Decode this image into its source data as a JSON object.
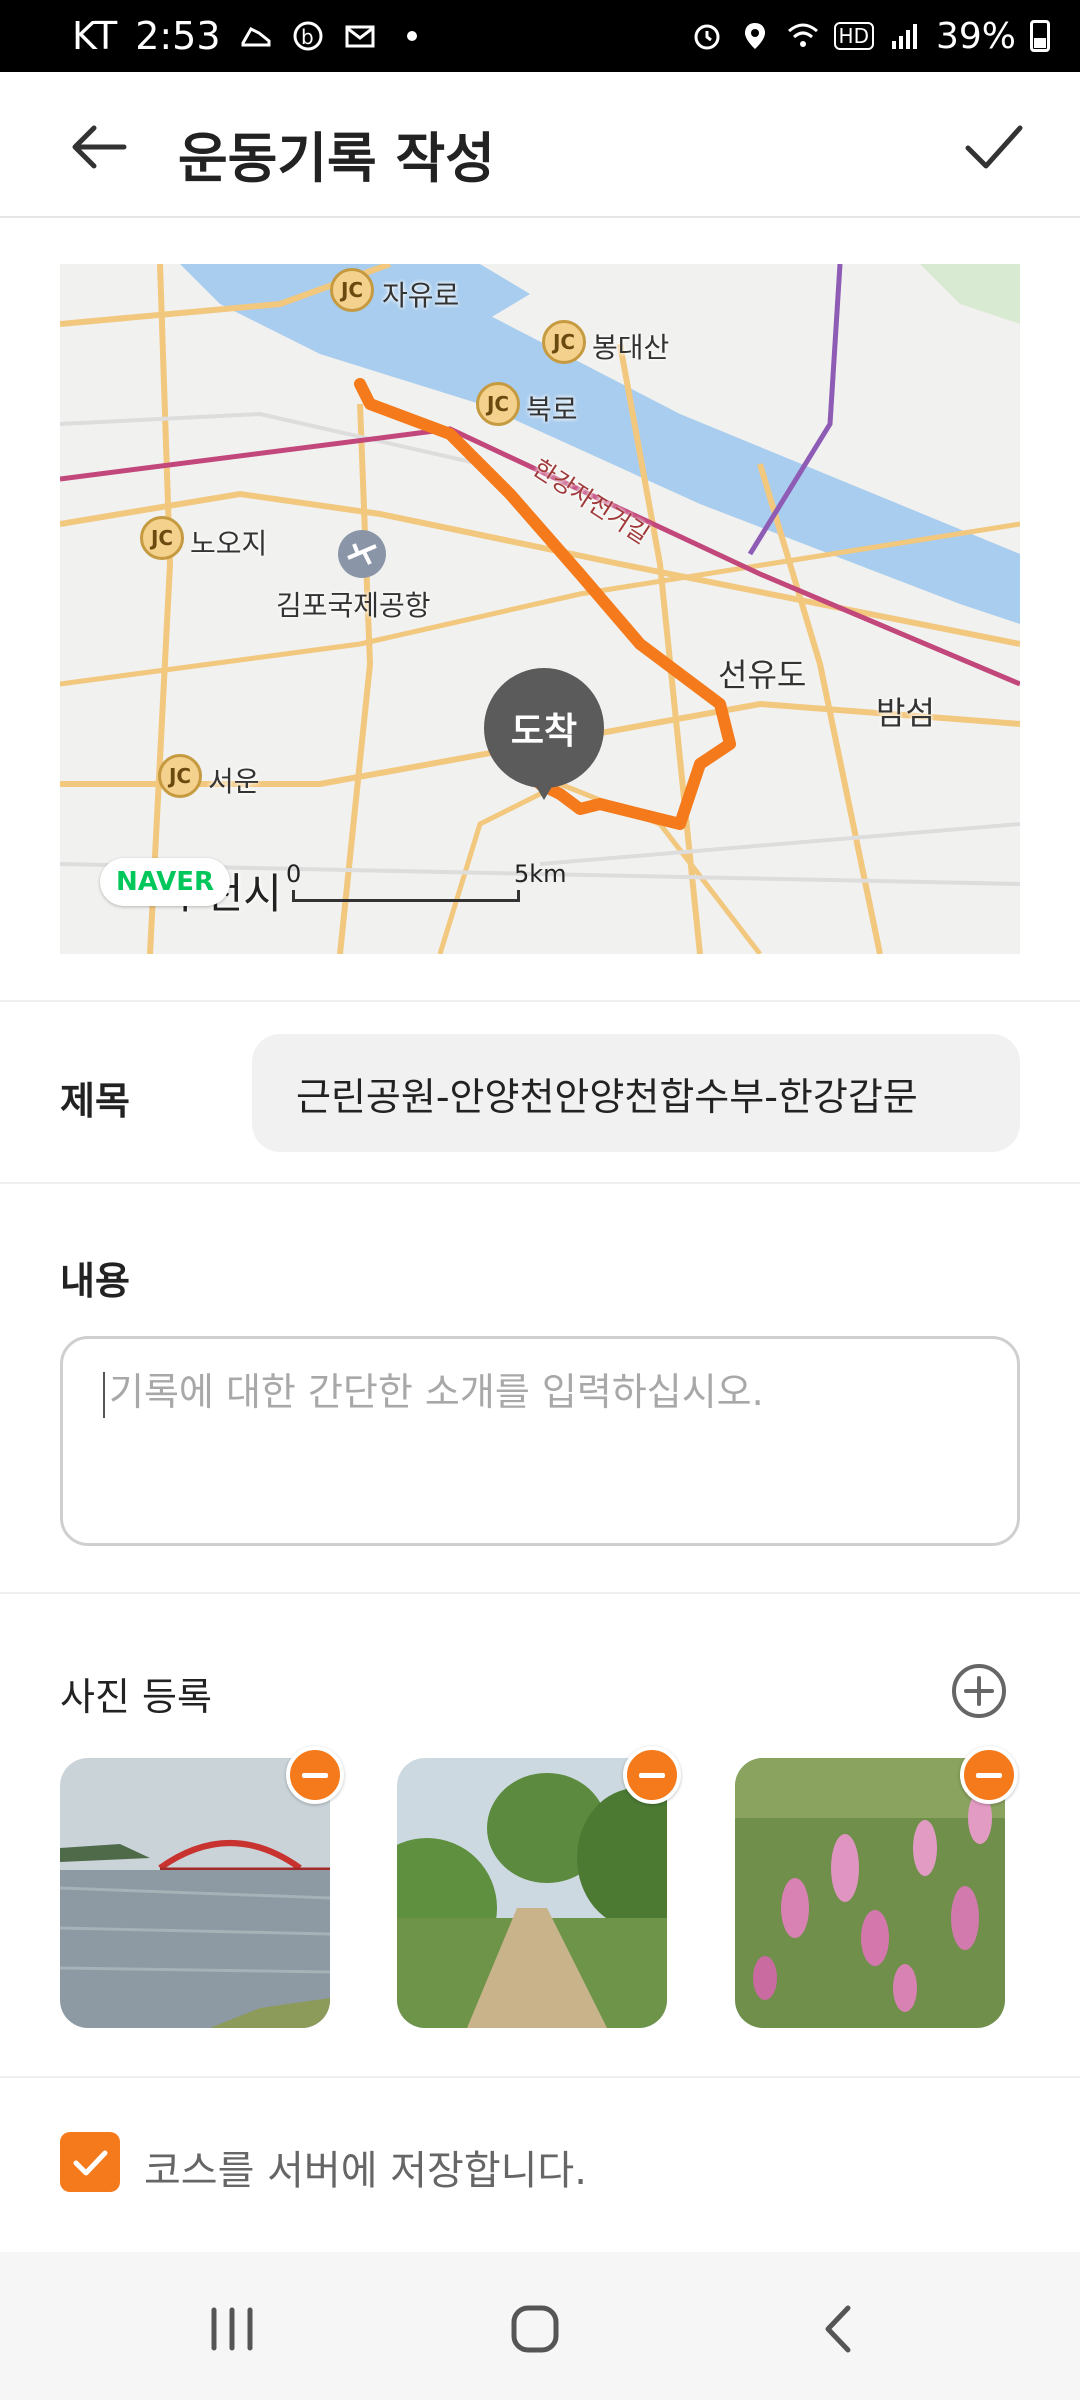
{
  "status_bar": {
    "carrier": "KT",
    "time": "2:53",
    "hd_label": "HD",
    "battery": "39%"
  },
  "app_bar": {
    "title": "운동기록 작성"
  },
  "map": {
    "labels": {
      "jayuro": "자유로",
      "bongdaesan": "봉대산",
      "bukro": "북로",
      "noji": "노오지",
      "airport": "김포국제공항",
      "bike_path": "한강자전거길",
      "seonyudo": "선유도",
      "bamseom": "밤섬",
      "seoun": "서운",
      "city": "부천시"
    },
    "jc_label": "JC",
    "pin_label": "도착",
    "naver_logo": "NAVER",
    "scale_start": "0",
    "scale_end": "5km",
    "colors": {
      "route": "#f47a1c",
      "river": "#a9cdee",
      "road": "#f2c77e",
      "subway": "#c2477a"
    }
  },
  "form": {
    "title_label": "제목",
    "title_value": "근린공원-안양천안양천합수부-한강갑문",
    "content_label": "내용",
    "content_placeholder": "기록에 대한 간단한 소개를 입력하십시오.",
    "photo_label": "사진 등록",
    "photos": [
      {
        "alt": "river-bridge-photo"
      },
      {
        "alt": "trail-photo"
      },
      {
        "alt": "flowers-photo"
      }
    ],
    "save_course_label": "코스를 서버에 저장합니다.",
    "save_course_checked": true
  },
  "accent_color": "#f47a1c"
}
